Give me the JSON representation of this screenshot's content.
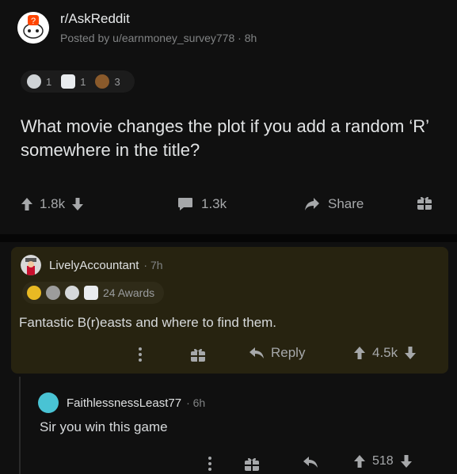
{
  "post": {
    "subreddit": "r/AskReddit",
    "meta": "Posted by u/earnmoney_survey778 · 8h",
    "awards": [
      {
        "icon": "silver-award-icon",
        "count": "1"
      },
      {
        "icon": "helpful-award-icon",
        "count": "1"
      },
      {
        "icon": "monkey-award-icon",
        "count": "3"
      }
    ],
    "title": "What movie changes the plot if you add a random ‘R’ somewhere in the title?",
    "score": "1.8k",
    "comments": "1.3k",
    "share_label": "Share"
  },
  "top_comment": {
    "author": "LivelyAccountant",
    "time": "· 7h",
    "awards_label": "24 Awards",
    "body": "Fantastic B(r)easts and where to find them.",
    "reply_label": "Reply",
    "score": "4.5k"
  },
  "reply_comment": {
    "author": "FaithlessnessLeast77",
    "time": "· 6h",
    "body": "Sir you win this game",
    "score": "518"
  },
  "colors": {
    "background": "#101010",
    "highlight_card": "#272310",
    "meta_text": "#818384"
  }
}
